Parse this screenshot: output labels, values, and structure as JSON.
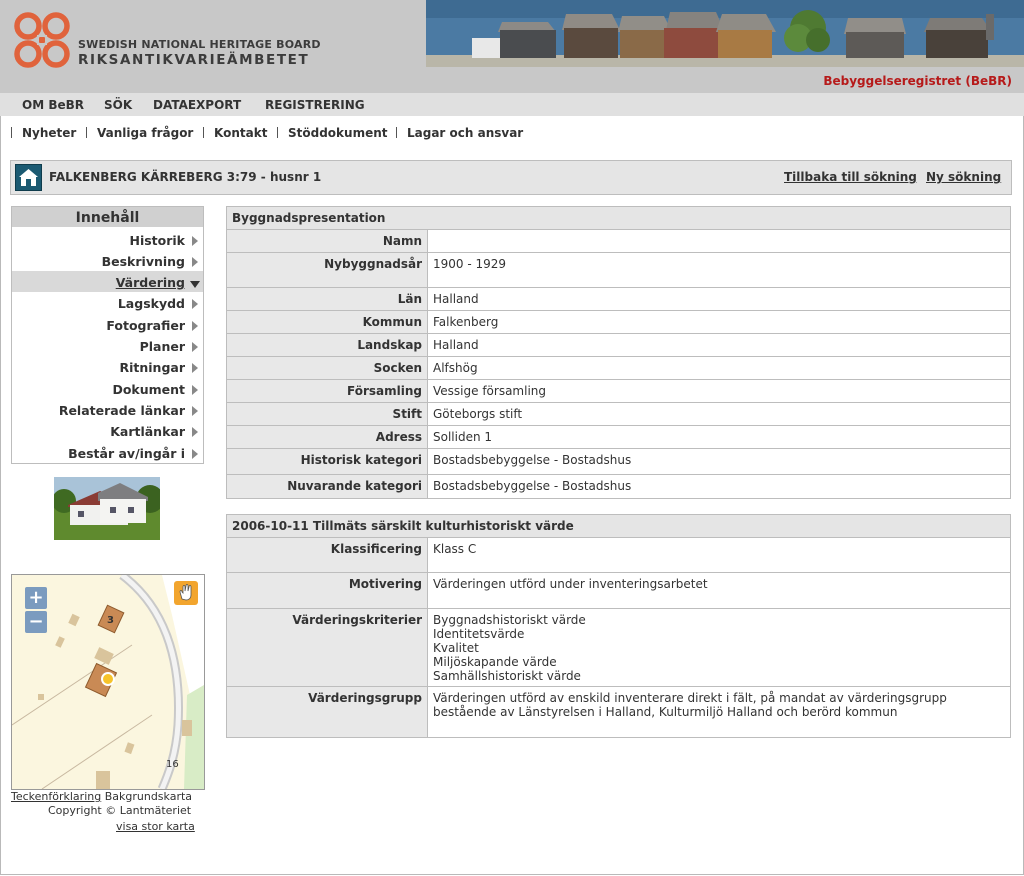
{
  "header": {
    "org_en": "SWEDISH NATIONAL HERITAGE BOARD",
    "org_sv": "RIKSANTIKVARIEÄMBETET",
    "brand": "Bebyggelseregistret (BeBR)",
    "accent_color": "#e0633c",
    "brand_color": "#b61a1a"
  },
  "main_menu": [
    "OM BeBR",
    "SÖK",
    "DATAEXPORT",
    "REGISTRERING"
  ],
  "sub_menu": [
    "Nyheter",
    "Vanliga frågor",
    "Kontakt",
    "Stöddokument",
    "Lagar och ansvar"
  ],
  "titlebar": {
    "icon": "house-icon",
    "title": "FALKENBERG KÄRREBERG 3:79 - husnr 1",
    "back": "Tillbaka till sökning",
    "new_search": "Ny sökning"
  },
  "toc": {
    "title": "Innehåll",
    "items": [
      "Historik",
      "Beskrivning",
      "Värdering",
      "Lagskydd",
      "Fotografier",
      "Planer",
      "Ritningar",
      "Dokument",
      "Relaterade länkar",
      "Kartlänkar",
      "Består av/ingår i"
    ],
    "active": "Värdering"
  },
  "map": {
    "zoom_in": "+",
    "zoom_out": "−",
    "label_3": "3",
    "label_16": "16",
    "legend": "Teckenförklaring",
    "background": "Bakgrundskarta",
    "copyright": "Copyright © Lantmäteriet",
    "large_map": "visa stor karta"
  },
  "presentation": {
    "title": "Byggnadspresentation",
    "rows": [
      {
        "key": "Namn",
        "val": ""
      },
      {
        "key": "Nybyggnadsår",
        "val": "1900 - 1929"
      },
      {
        "key": "Län",
        "val": "Halland"
      },
      {
        "key": "Kommun",
        "val": "Falkenberg"
      },
      {
        "key": "Landskap",
        "val": "Halland"
      },
      {
        "key": "Socken",
        "val": "Alfshög"
      },
      {
        "key": "Församling",
        "val": "Vessige församling"
      },
      {
        "key": "Stift",
        "val": "Göteborgs stift"
      },
      {
        "key": "Adress",
        "val": "Solliden 1"
      },
      {
        "key": "Historisk kategori",
        "val": "Bostadsbebyggelse - Bostadshus"
      },
      {
        "key": "Nuvarande kategori",
        "val": "Bostadsbebyggelse - Bostadshus"
      }
    ]
  },
  "valuation": {
    "title": "2006-10-11 Tillmäts särskilt kulturhistoriskt värde",
    "rows": [
      {
        "key": "Klassificering",
        "lines": [
          "Klass C"
        ]
      },
      {
        "key": "Motivering",
        "lines": [
          "Värderingen utförd under inventeringsarbetet"
        ]
      },
      {
        "key": "Värderingskriterier",
        "lines": [
          "Byggnadshistoriskt värde",
          "Identitetsvärde",
          "Kvalitet",
          "Miljöskapande värde",
          "Samhällshistoriskt värde"
        ]
      },
      {
        "key": "Värderingsgrupp",
        "lines": [
          "Värderingen utförd av enskild inventerare direkt i fält, på mandat av värderingsgrupp",
          "bestående av Länstyrelsen i Halland, Kulturmiljö Halland och berörd kommun"
        ]
      }
    ]
  }
}
